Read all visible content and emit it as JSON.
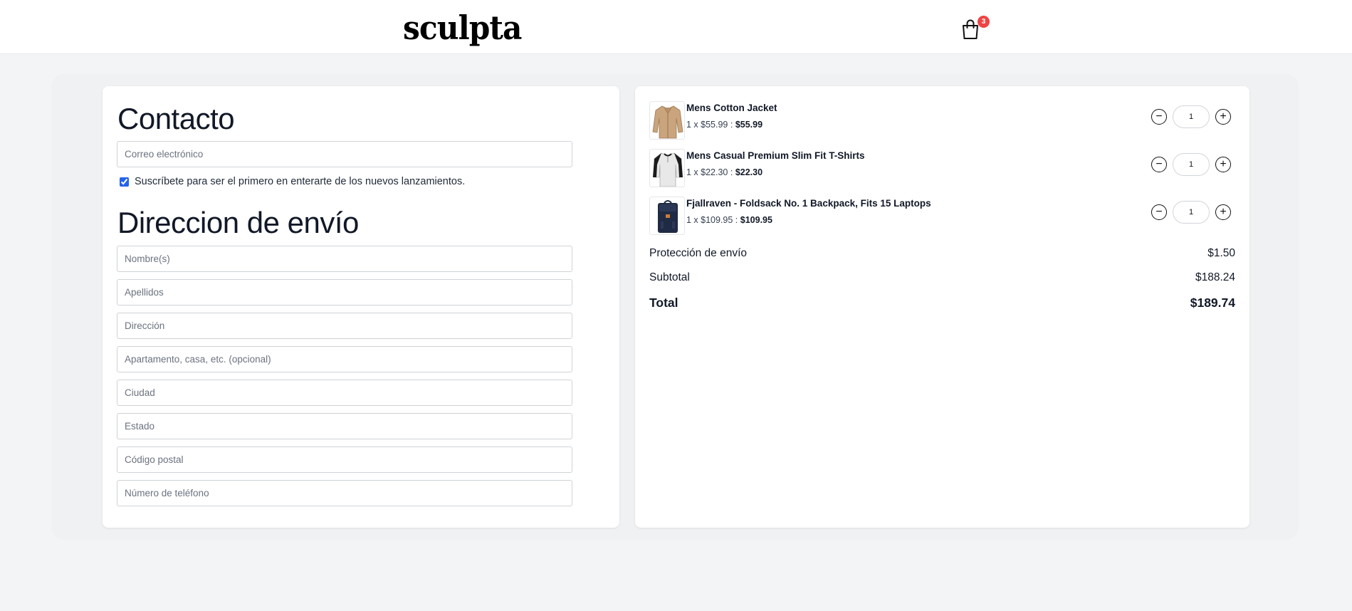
{
  "header": {
    "logo": "sculpta",
    "cart_count": "3"
  },
  "contact": {
    "title": "Contacto",
    "email_placeholder": "Correo electrónico",
    "subscribe_label": "Suscríbete para ser el primero en enterarte de los nuevos lanzamientos.",
    "subscribe_checked": true
  },
  "shipping": {
    "title": "Direccion de envío",
    "fields": [
      {
        "placeholder": "Nombre(s)"
      },
      {
        "placeholder": "Apellidos"
      },
      {
        "placeholder": "Dirección"
      },
      {
        "placeholder": "Apartamento, casa, etc. (opcional)"
      },
      {
        "placeholder": "Ciudad"
      },
      {
        "placeholder": "Estado"
      },
      {
        "placeholder": "Código postal"
      },
      {
        "placeholder": "Número de teléfono"
      }
    ]
  },
  "cart": {
    "items": [
      {
        "name": "Mens Cotton Jacket",
        "unit": "1 x $55.99 :",
        "total": "$55.99",
        "qty": "1",
        "image": "jacket"
      },
      {
        "name": "Mens Casual Premium Slim Fit T-Shirts",
        "unit": "1 x $22.30 :",
        "total": "$22.30",
        "qty": "1",
        "image": "raglan-shirt"
      },
      {
        "name": "Fjallraven - Foldsack No. 1 Backpack, Fits 15 Laptops",
        "unit": "1 x $109.95 :",
        "total": "$109.95",
        "qty": "1",
        "image": "backpack"
      }
    ],
    "minus_icon": "minus-circle-icon",
    "plus_icon": "plus-circle-icon"
  },
  "summary": {
    "shipping_label": "Protección de envío",
    "shipping_value": "$1.50",
    "subtotal_label": "Subtotal",
    "subtotal_value": "$188.24",
    "total_label": "Total",
    "total_value": "$189.74"
  },
  "colors": {
    "badge": "#ef4444",
    "background": "#f3f4f6",
    "checkbox": "#2563eb"
  }
}
